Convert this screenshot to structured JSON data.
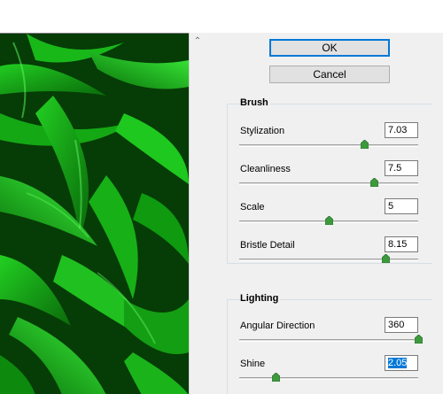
{
  "buttons": {
    "ok": "OK",
    "cancel": "Cancel"
  },
  "brush": {
    "title": "Brush",
    "sliders": [
      {
        "label": "Stylization",
        "value": "7.03",
        "position": 0.7
      },
      {
        "label": "Cleanliness",
        "value": "7.5",
        "position": 0.75
      },
      {
        "label": "Scale",
        "value": "5",
        "position": 0.5
      },
      {
        "label": "Bristle Detail",
        "value": "8.15",
        "position": 0.815
      }
    ]
  },
  "lighting": {
    "title": "Lighting",
    "sliders": [
      {
        "label": "Angular Direction",
        "value": "360",
        "position": 1.0
      },
      {
        "label": "Shine",
        "value": "2.05",
        "position": 0.205,
        "selected": true
      }
    ]
  },
  "preview": {
    "description_icon": "oil-paint-preview"
  },
  "colors": {
    "accent": "#0078d7",
    "panel": "#f0f0f0",
    "thumb": "#3c9a3c"
  }
}
